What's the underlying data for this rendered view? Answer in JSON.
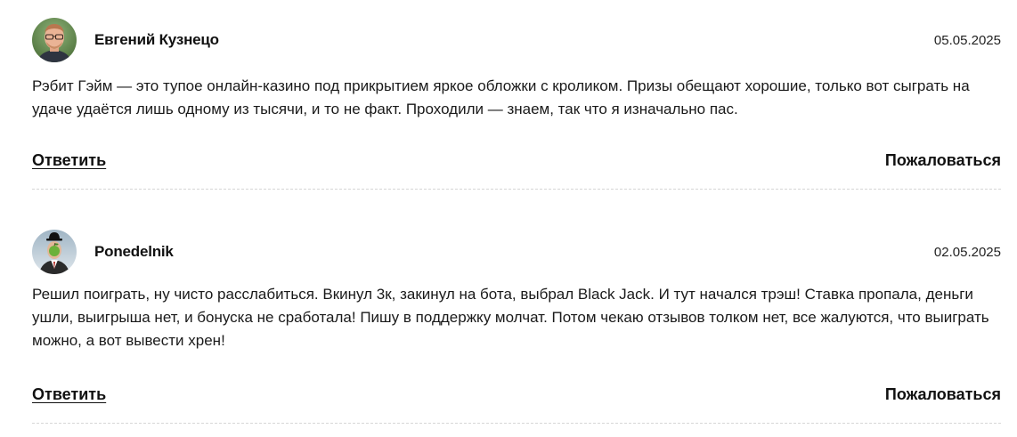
{
  "comments": [
    {
      "author": "Евгений Кузнецо",
      "avatar_icon": "user-photo-man-glasses",
      "date": "05.05.2025",
      "text": "Рэбит Гэйм — это тупое онлайн-казино под прикрытием яркое обложки с кроликом. Призы обещают хорошие, только вот сыграть на удаче удаётся лишь одному из тысячи, и то не факт. Проходили — знаем, так что я изначально пас.",
      "reply_label": "Ответить",
      "report_label": "Пожаловаться"
    },
    {
      "author": "Ponedelnik",
      "avatar_icon": "user-avatar-man-bowler-hat-apple",
      "date": "02.05.2025",
      "text": "Решил поиграть, ну чисто расслабиться. Вкинул 3к, закинул на бота, выбрал Black Jack. И тут начался трэш! Ставка пропала, деньги ушли, выигрыша нет, и бонуска не сработала! Пишу в поддержку молчат. Потом чекаю отзывов толком нет, все жалуются, что выиграть можно, а вот вывести хрен!",
      "reply_label": "Ответить",
      "report_label": "Пожаловаться"
    }
  ]
}
